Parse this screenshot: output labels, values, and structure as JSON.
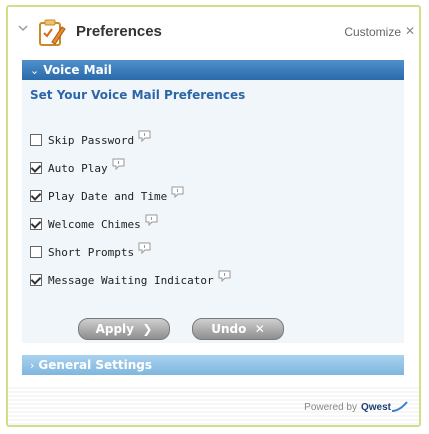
{
  "widget": {
    "title": "Preferences",
    "customize": "Customize",
    "close": "✕"
  },
  "voicemail": {
    "header": "Voice Mail",
    "heading": "Set Your Voice Mail Preferences",
    "options": [
      {
        "label": "Skip Password",
        "checked": false
      },
      {
        "label": "Auto Play",
        "checked": true
      },
      {
        "label": "Play Date and Time",
        "checked": true
      },
      {
        "label": "Welcome Chimes",
        "checked": true
      },
      {
        "label": "Short Prompts",
        "checked": false
      },
      {
        "label": "Message Waiting Indicator",
        "checked": true
      }
    ],
    "apply_label": "Apply",
    "undo_label": "Undo"
  },
  "general": {
    "header": "General Settings"
  },
  "footer": {
    "powered_by": "Powered by",
    "brand": "Qwest"
  },
  "colors": {
    "accent_blue": "#2a6aab",
    "heading_blue": "#2d66a8",
    "border_green": "#cfe08a"
  }
}
